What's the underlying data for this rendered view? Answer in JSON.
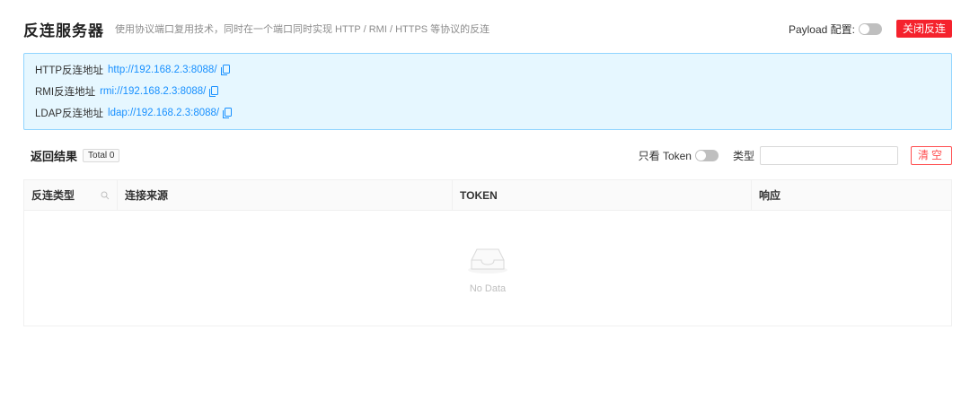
{
  "header": {
    "title": "反连服务器",
    "subtitle": "使用协议端口复用技术，同时在一个端口同时实现 HTTP / RMI / HTTPS 等协议的反连",
    "payload_label": "Payload 配置:",
    "payload_enabled": false,
    "close_label": "关闭反连"
  },
  "info": {
    "rows": [
      {
        "label": "HTTP反连地址",
        "url": "http://192.168.2.3:8088/"
      },
      {
        "label": "RMI反连地址",
        "url": "rmi://192.168.2.3:8088/"
      },
      {
        "label": "LDAP反连地址",
        "url": "ldap://192.168.2.3:8088/"
      }
    ]
  },
  "results": {
    "label": "返回结果",
    "total": "Total 0",
    "token_only_label": "只看 Token",
    "token_only_enabled": false,
    "type_label": "类型",
    "type_value": "",
    "clear_label": "清空"
  },
  "table": {
    "columns": [
      "反连类型",
      "连接来源",
      "TOKEN",
      "响应"
    ],
    "rows": [],
    "empty_text": "No Data"
  },
  "colors": {
    "danger": "#f5222d",
    "link": "#1890ff",
    "info_bg": "#e6f7ff"
  }
}
